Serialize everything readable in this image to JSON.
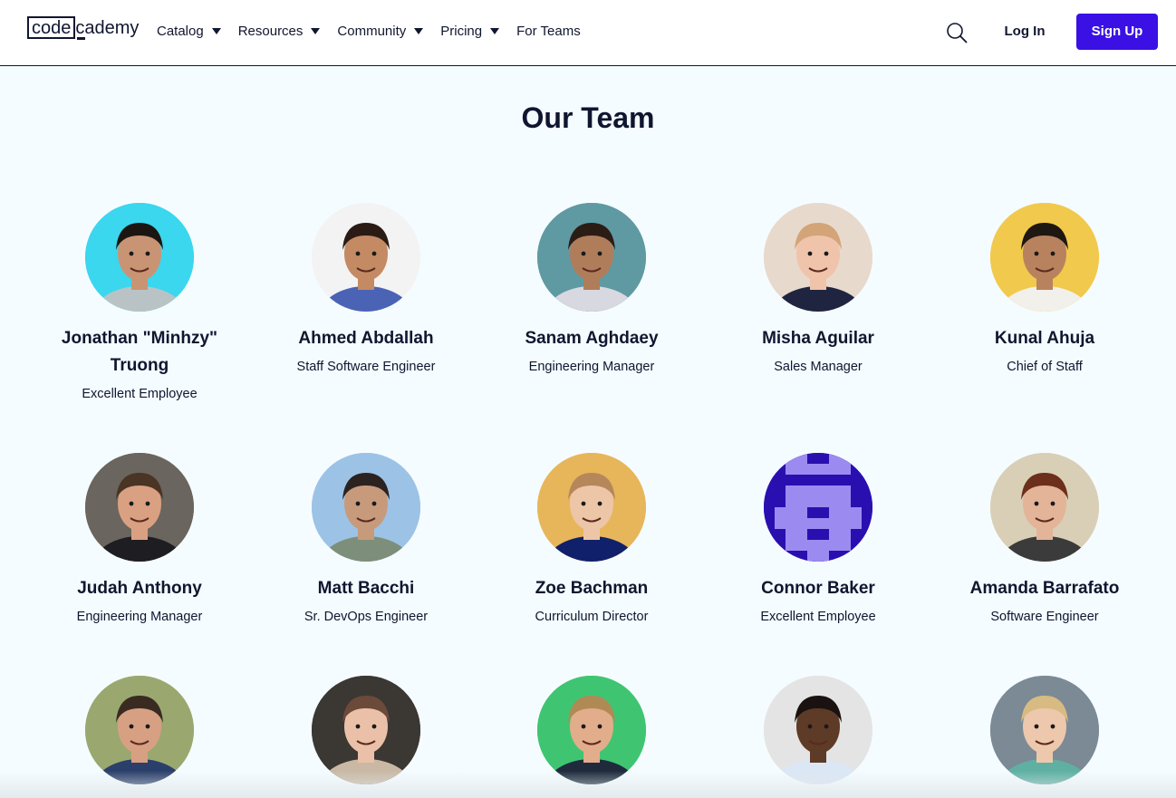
{
  "brand": {
    "logo_part1": "code",
    "logo_part2": "cademy",
    "accent": "#3a10e5",
    "navy": "#10162f"
  },
  "nav": [
    {
      "label": "Catalog",
      "dropdown": true
    },
    {
      "label": "Resources",
      "dropdown": true
    },
    {
      "label": "Community",
      "dropdown": true
    },
    {
      "label": "Pricing",
      "dropdown": true
    },
    {
      "label": "For Teams",
      "dropdown": false
    }
  ],
  "header": {
    "search_icon": "search-icon",
    "login_label": "Log In",
    "signup_label": "Sign Up"
  },
  "page": {
    "title": "Our Team"
  },
  "team": [
    {
      "name": "Jonathan \"Minhzy\" Truong",
      "role": "Excellent Employee",
      "bg": "#3ad7ee",
      "skin": "#c99474",
      "hair": "#1c1612",
      "shirt": "#b9c3c6"
    },
    {
      "name": "Ahmed Abdallah",
      "role": "Staff Software Engineer",
      "bg": "#f3f3f3",
      "skin": "#c48a63",
      "hair": "#2a1c14",
      "shirt": "#4b63b5"
    },
    {
      "name": "Sanam Aghdaey",
      "role": "Engineering Manager",
      "bg": "#5f9aa3",
      "skin": "#b07d5b",
      "hair": "#2b1d15",
      "shirt": "#d8d8e0"
    },
    {
      "name": "Misha Aguilar",
      "role": "Sales Manager",
      "bg": "#e8d9cd",
      "skin": "#efc4aa",
      "hair": "#d2a477",
      "shirt": "#1f2540"
    },
    {
      "name": "Kunal Ahuja",
      "role": "Chief of Staff",
      "bg": "#f1c94c",
      "skin": "#b9825e",
      "hair": "#1f1712",
      "shirt": "#f2f0ea"
    },
    {
      "name": "Judah Anthony",
      "role": "Engineering Manager",
      "bg": "#6a655e",
      "skin": "#d9a182",
      "hair": "#4a3424",
      "shirt": "#1d1d22"
    },
    {
      "name": "Matt Bacchi",
      "role": "Sr. DevOps Engineer",
      "bg": "#9cc3e6",
      "skin": "#c79a7c",
      "hair": "#2b2320",
      "shirt": "#7d8f7a"
    },
    {
      "name": "Zoe Bachman",
      "role": "Curriculum Director",
      "bg": "#e7b65b",
      "skin": "#edc6a8",
      "hair": "#b5875a",
      "shirt": "#10206a"
    },
    {
      "name": "Connor Baker",
      "role": "Excellent Employee",
      "bg": "#2a0fb0",
      "skin": "#9b8bf0",
      "hair": "#9b8bf0",
      "shirt": "#9b8bf0"
    },
    {
      "name": "Amanda Barrafato",
      "role": "Software Engineer",
      "bg": "#d9cfb6",
      "skin": "#e3b498",
      "hair": "#6b2f1c",
      "shirt": "#3b3b3b"
    },
    {
      "name": "",
      "role": "",
      "bg": "#9aa870",
      "skin": "#d8a083",
      "hair": "#3a2b22",
      "shirt": "#2b3f6b"
    },
    {
      "name": "",
      "role": "",
      "bg": "#3b3733",
      "skin": "#eac1a8",
      "hair": "#6b4a3a",
      "shirt": "#c9b9a4"
    },
    {
      "name": "",
      "role": "",
      "bg": "#3fc571",
      "skin": "#e2ad8a",
      "hair": "#b08a55",
      "shirt": "#1f2b3d"
    },
    {
      "name": "",
      "role": "",
      "bg": "#e4e4e4",
      "skin": "#5e3b26",
      "hair": "#1a1210",
      "shirt": "#dbe7f5"
    },
    {
      "name": "",
      "role": "",
      "bg": "#7b8a95",
      "skin": "#edc8ad",
      "hair": "#d8bb82",
      "shirt": "#5fb0a3"
    }
  ]
}
